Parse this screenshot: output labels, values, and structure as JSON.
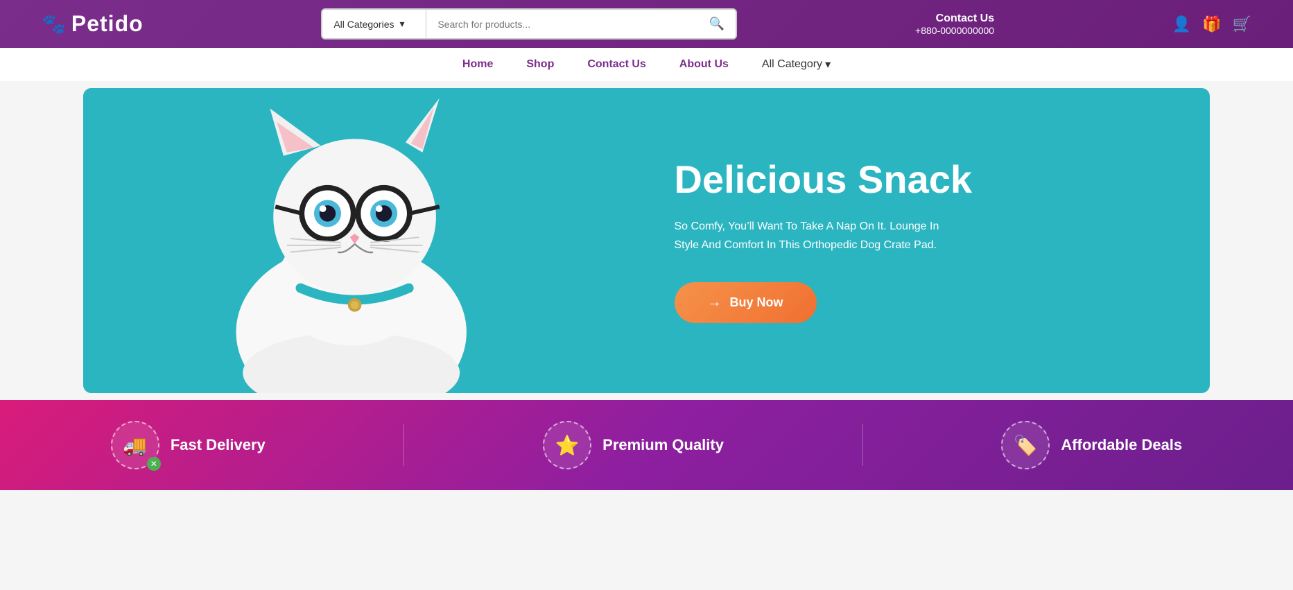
{
  "brand": {
    "name": "Petido",
    "logo_icon": "🐾"
  },
  "header": {
    "contact_label": "Contact Us",
    "contact_phone": "+880-0000000000",
    "search_placeholder": "Search for products...",
    "category_dropdown_label": "All Categories"
  },
  "nav": {
    "items": [
      {
        "id": "home",
        "label": "Home",
        "active": true
      },
      {
        "id": "shop",
        "label": "Shop",
        "active": false
      },
      {
        "id": "contact",
        "label": "Contact Us",
        "active": false
      },
      {
        "id": "about",
        "label": "About Us",
        "active": false
      },
      {
        "id": "all-category",
        "label": "All Category",
        "has_dropdown": true
      }
    ]
  },
  "hero": {
    "title": "Delicious Snack",
    "description": "So Comfy, You’ll Want To Take A Nap On It. Lounge In Style And Comfort In This Orthopedic Dog Crate Pad.",
    "cta_label": "Buy Now"
  },
  "features": [
    {
      "id": "fast-delivery",
      "icon": "🚚",
      "label": "Fast Delivery"
    },
    {
      "id": "premium-quality",
      "icon": "⭐",
      "label": "Premium Quality"
    },
    {
      "id": "affordable-deals",
      "icon": "🏷️",
      "label": "Affordable Deals"
    }
  ],
  "colors": {
    "header_bg": "#7b2d8b",
    "nav_bg": "#ffffff",
    "hero_bg": "#2ab5c0",
    "features_bg_start": "#d91c7a",
    "features_bg_end": "#6b1f8c",
    "cta_btn": "#f5924a",
    "accent_purple": "#7b2d8b"
  }
}
